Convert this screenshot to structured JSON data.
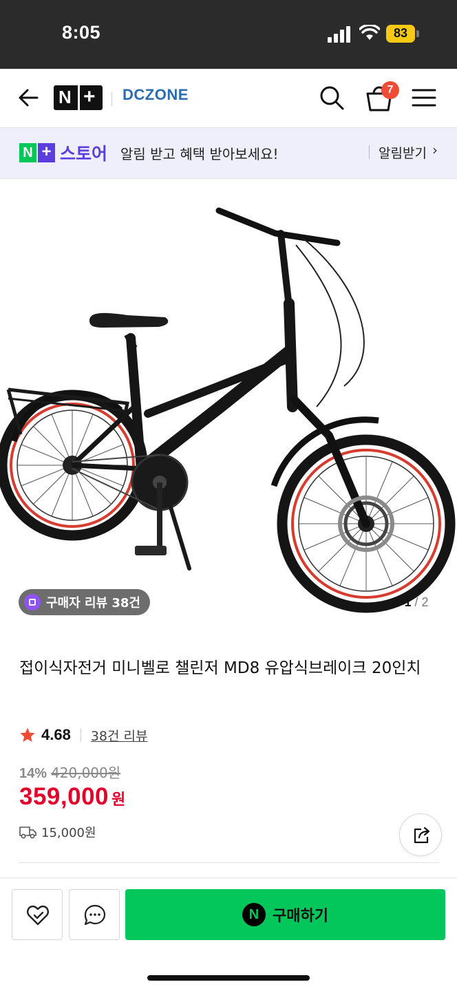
{
  "status_bar": {
    "time": "8:05",
    "battery": "83",
    "icons": [
      "signal-icon",
      "wifi-icon",
      "battery-icon"
    ]
  },
  "header": {
    "logo_letter": "N",
    "logo_plus": "+",
    "store_name": "DCZONE",
    "cart_count": "7",
    "icons": [
      "back-arrow-icon",
      "search-icon",
      "cart-icon",
      "menu-icon"
    ]
  },
  "banner": {
    "logo_n": "N",
    "logo_plus": "+",
    "store_label": "스토어",
    "message": "알림 받고 혜택 받아보세요!",
    "link_label": "알림받기",
    "chevron": "›"
  },
  "gallery": {
    "review_chip": "구매자 리뷰 38건",
    "current_page": "1",
    "separator": "/",
    "total_pages": "2"
  },
  "product": {
    "title": "접이식자전거 미니벨로 챌린저 MD8 유압식브레이크 20인치",
    "rating": "4.68",
    "review_link": "38건 리뷰",
    "discount_rate": "14%",
    "original_price": "420,000원",
    "sale_price": "359,000",
    "sale_unit": "원",
    "shipping_fee": "15,000원"
  },
  "bottom_bar": {
    "buy_icon_letter": "N",
    "buy_label": "구매하기",
    "icons": [
      "heart-icon",
      "chat-icon"
    ]
  },
  "colors": {
    "naver_green": "#03c75a",
    "store_purple": "#5c3ede",
    "price_red": "#e4002b",
    "badge_red": "#f04b35",
    "battery_yellow": "#f6c915"
  }
}
